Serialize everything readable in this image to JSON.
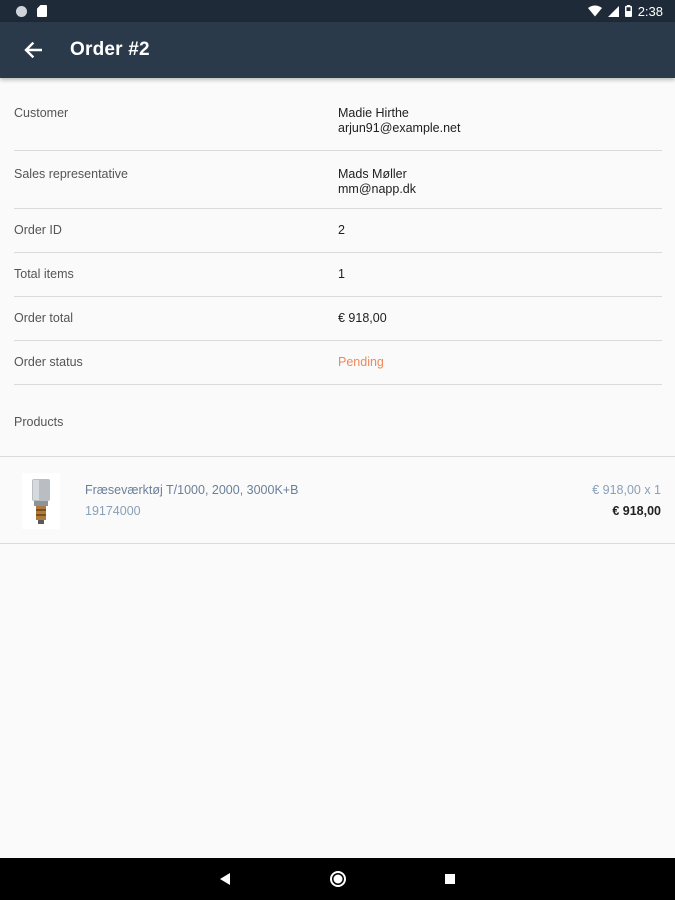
{
  "status_bar": {
    "time": "2:38",
    "icons": [
      "circle-notification-icon",
      "sd-card-icon",
      "wifi-icon",
      "signal-icon",
      "battery-icon"
    ]
  },
  "app_bar": {
    "title": "Order #2",
    "back_icon": "arrow-back-icon"
  },
  "details": {
    "customer": {
      "label": "Customer",
      "name": "Madie Hirthe",
      "email": "arjun91@example.net"
    },
    "sales_rep": {
      "label": "Sales representative",
      "name": "Mads Møller",
      "email": "mm@napp.dk"
    },
    "order_id": {
      "label": "Order ID",
      "value": "2"
    },
    "total_items": {
      "label": "Total items",
      "value": "1"
    },
    "order_total": {
      "label": "Order total",
      "value": "€ 918,00"
    },
    "order_status": {
      "label": "Order status",
      "value": "Pending",
      "color": "#f0885a"
    }
  },
  "products": {
    "header": "Products",
    "items": [
      {
        "name": "Fræseværktøj T/1000, 2000, 3000K+B",
        "sku": "19174000",
        "unit_price": "€ 918,00 x 1",
        "line_total": "€ 918,00"
      }
    ]
  },
  "nav_bar": {
    "icons": [
      "nav-back-icon",
      "nav-home-icon",
      "nav-recents-icon"
    ]
  },
  "colors": {
    "status_bar": "#1e2a38",
    "app_bar": "#2b3a4a",
    "background": "#fafafa",
    "accent_link": "#6b7f99"
  }
}
